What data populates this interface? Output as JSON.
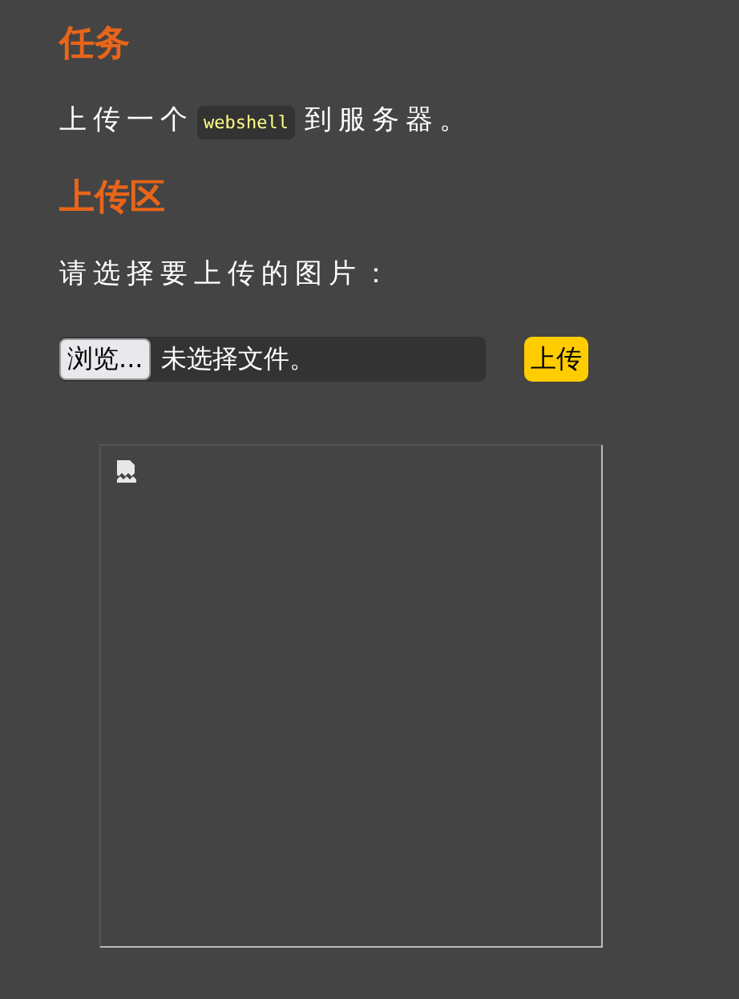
{
  "task": {
    "heading": "任务",
    "text_before": "上传一个",
    "code": "webshell",
    "text_after": "到服务器。"
  },
  "upload": {
    "heading": "上传区",
    "prompt": "请选择要上传的图片：",
    "browse_button": "浏览...",
    "file_status": "未选择文件。",
    "submit_button": "上传"
  },
  "preview": {
    "broken": true
  }
}
